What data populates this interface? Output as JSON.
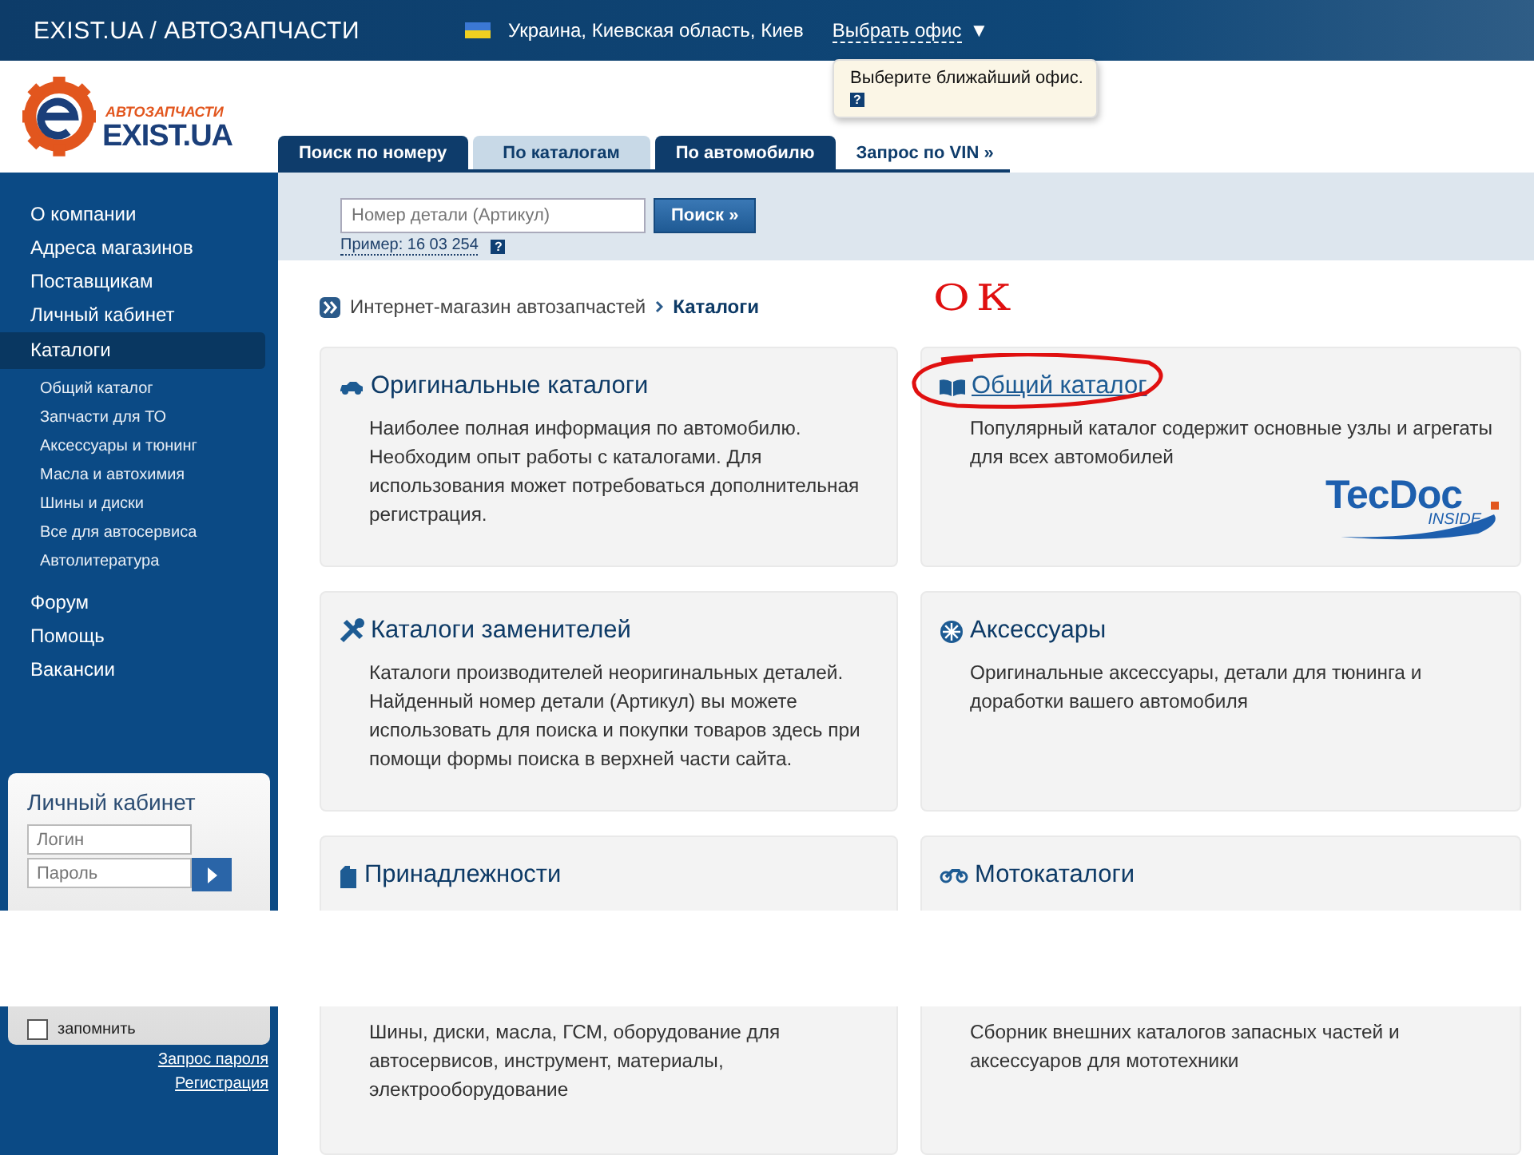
{
  "top_bar": {
    "title": "EXIST.UA / АВТОЗАПЧАСТИ",
    "location": "Украина, Киевская область, Киев",
    "office_link": "Выбрать офис",
    "office_caret": "▼"
  },
  "tooltip": {
    "text": "Выберите ближайший офис.",
    "help": "?"
  },
  "logo": {
    "tagline": "АВТОЗАПЧАСТИ",
    "name": "EXIST.UA"
  },
  "tabs": [
    {
      "label": "Поиск по номеру",
      "kind": "tab",
      "selected": false
    },
    {
      "label": "По каталогам",
      "kind": "tab",
      "selected": true
    },
    {
      "label": "По автомобилю",
      "kind": "tab",
      "selected": false
    },
    {
      "label": "Запрос по VIN »",
      "kind": "link",
      "selected": false
    }
  ],
  "search": {
    "placeholder": "Номер детали (Артикул)",
    "button": "Поиск »",
    "example": "Пример: 16 03 254",
    "help": "?"
  },
  "sidebar": {
    "items": [
      {
        "label": "О компании",
        "selected": false
      },
      {
        "label": "Адреса магазинов",
        "selected": false
      },
      {
        "label": "Поставщикам",
        "selected": false
      },
      {
        "label": "Личный кабинет",
        "selected": false
      },
      {
        "label": "Каталоги",
        "selected": true,
        "children": [
          {
            "label": "Общий каталог"
          },
          {
            "label": "Запчасти для ТО"
          },
          {
            "label": "Аксессуары и тюнинг"
          },
          {
            "label": "Масла и автохимия"
          },
          {
            "label": "Шины и диски"
          },
          {
            "label": "Все для автосервиса"
          },
          {
            "label": "Автолитература"
          }
        ]
      },
      {
        "label": "Форум",
        "selected": false
      },
      {
        "label": "Помощь",
        "selected": false
      },
      {
        "label": "Вакансии",
        "selected": false
      }
    ]
  },
  "login": {
    "title": "Личный кабинет",
    "login_placeholder": "Логин",
    "password_placeholder": "Пароль",
    "remember": {
      "label": "запомнить",
      "checked": false
    },
    "links": [
      "Запрос пароля",
      "Регистрация"
    ]
  },
  "breadcrumb": [
    {
      "label": "Интернет-магазин автозапчастей",
      "current": false
    },
    {
      "label": "Каталоги",
      "current": true
    }
  ],
  "annotation": {
    "text": "ОК"
  },
  "cards": [
    {
      "kind": "car",
      "title": "Оригинальные каталоги",
      "link": false,
      "description": "Наиболее полная информация по автомобилю. Необходим опыт работы с каталогами. Для использования может потребоваться дополнительная регистрация."
    },
    {
      "kind": "book",
      "title": "Общий каталог",
      "link": true,
      "circled": true,
      "description": "Популярный каталог содержит основные узлы и агрегаты для всех автомобилей",
      "badge": {
        "name": "TecDoc",
        "sub": "INSIDE"
      }
    },
    {
      "kind": "tools",
      "title": "Каталоги заменителей",
      "link": false,
      "description": "Каталоги производителей неоригинальных деталей. Найденный номер детали (Артикул) вы можете использовать для поиска и покупки товаров здесь при помощи формы поиска в верхней части сайта."
    },
    {
      "kind": "wheel",
      "title": "Аксессуары",
      "link": false,
      "description": "Оригинальные аксессуары, детали для тюнинга и доработки вашего автомобиля"
    },
    {
      "kind": "canister",
      "title": "Принадлежности",
      "link": false,
      "description": "Шины, диски, масла, ГСМ, оборудование для автосервисов, инструмент, материалы, электрооборудование"
    },
    {
      "kind": "moto",
      "title": "Мотокаталоги",
      "link": false,
      "description": "Сборник внешних каталогов запасных частей и аксессуаров для мототехники"
    }
  ]
}
